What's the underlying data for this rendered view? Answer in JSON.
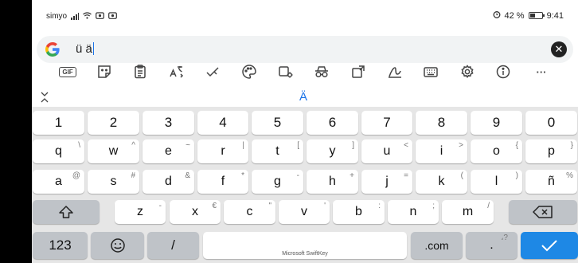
{
  "status": {
    "carrier": "simyo",
    "battery": "42 %",
    "time": "9:41"
  },
  "search": {
    "query": "ü ä",
    "clear_symbol": "✕"
  },
  "toolbar": {
    "gif_label": "GIF",
    "more_label": "···"
  },
  "prediction": {
    "text": "Ä"
  },
  "keyboard": {
    "numbers": [
      "1",
      "2",
      "3",
      "4",
      "5",
      "6",
      "7",
      "8",
      "9",
      "0"
    ],
    "row1": [
      {
        "key": "q",
        "hint": "\\"
      },
      {
        "key": "w",
        "hint": "^"
      },
      {
        "key": "e",
        "hint": "~"
      },
      {
        "key": "r",
        "hint": "|"
      },
      {
        "key": "t",
        "hint": "["
      },
      {
        "key": "y",
        "hint": "]"
      },
      {
        "key": "u",
        "hint": "<"
      },
      {
        "key": "i",
        "hint": ">"
      },
      {
        "key": "o",
        "hint": "{"
      },
      {
        "key": "p",
        "hint": "}"
      }
    ],
    "row2": [
      {
        "key": "a",
        "hint": "@"
      },
      {
        "key": "s",
        "hint": "#"
      },
      {
        "key": "d",
        "hint": "&"
      },
      {
        "key": "f",
        "hint": "*"
      },
      {
        "key": "g",
        "hint": "-"
      },
      {
        "key": "h",
        "hint": "+"
      },
      {
        "key": "j",
        "hint": "="
      },
      {
        "key": "k",
        "hint": "("
      },
      {
        "key": "l",
        "hint": ")"
      },
      {
        "key": "ñ",
        "hint": "%"
      }
    ],
    "row3": [
      {
        "key": "z",
        "hint": "-"
      },
      {
        "key": "x",
        "hint": "€"
      },
      {
        "key": "c",
        "hint": "\""
      },
      {
        "key": "v",
        "hint": "'"
      },
      {
        "key": "b",
        "hint": ":"
      },
      {
        "key": "n",
        "hint": ";"
      },
      {
        "key": "m",
        "hint": "/"
      }
    ],
    "bottom": {
      "numeric": "123",
      "slash": "/",
      "space_label": "Microsoft SwiftKey",
      "dotcom": ".com",
      "period": ".",
      "period_hint": "،?"
    }
  },
  "colors": {
    "accent": "#1e88e5",
    "keyboard_bg": "#e6e6e6"
  }
}
